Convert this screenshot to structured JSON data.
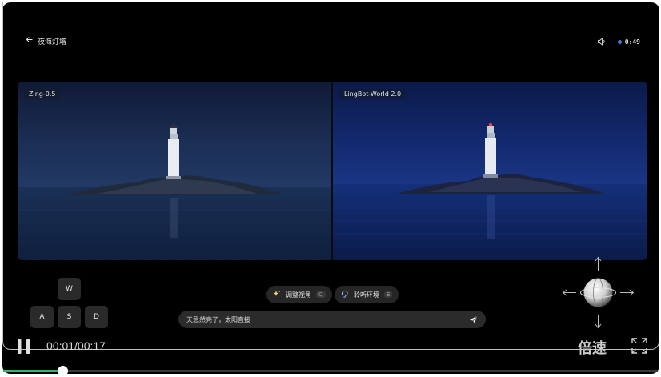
{
  "header": {
    "back_label": "夜海灯塔",
    "timer": "0:49"
  },
  "panels": {
    "left_label": "Zing-0.5",
    "right_label": "LingBot-World 2.0"
  },
  "keys": {
    "w": "W",
    "a": "A",
    "s": "S",
    "d": "D"
  },
  "actions": {
    "adjust_view": {
      "label": "调整视角",
      "hint": "Q"
    },
    "listen_env": {
      "label": "聆听环境",
      "hint": "E"
    }
  },
  "prompt": {
    "value": "天急然亮了，太阳直接"
  },
  "playback": {
    "time": "00:01/00:17",
    "speed_label": "倍速",
    "progress_fraction": 0.09
  },
  "colors": {
    "accent_green": "#3bb36b",
    "timer_dot": "#4a7fd6"
  }
}
